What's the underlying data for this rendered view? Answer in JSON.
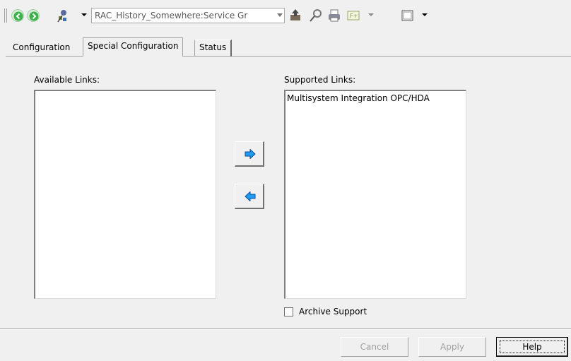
{
  "toolbar": {
    "selector_value": "RAC_History_Somewhere:Service Gr",
    "icons": [
      "back-icon",
      "forward-icon",
      "object-tree-icon",
      "export-icon",
      "pin-icon",
      "print-icon",
      "function-icon",
      "window-icon"
    ]
  },
  "tabs": [
    {
      "label": "Configuration",
      "selected": false
    },
    {
      "label": "Special Configuration",
      "selected": true
    },
    {
      "label": "Status",
      "selected": false
    }
  ],
  "available_links": {
    "label": "Available Links:",
    "items": []
  },
  "supported_links": {
    "label": "Supported Links:",
    "items": [
      "Multisystem Integration OPC/HDA"
    ]
  },
  "archive_support": {
    "label": "Archive Support",
    "checked": false
  },
  "footer": {
    "cancel_label": "Cancel",
    "apply_label": "Apply",
    "help_label": "Help"
  },
  "colors": {
    "window_bg": "#f0f0f0",
    "arrow_blue": "#1e9af0",
    "nav_green": "#3cb34a"
  }
}
